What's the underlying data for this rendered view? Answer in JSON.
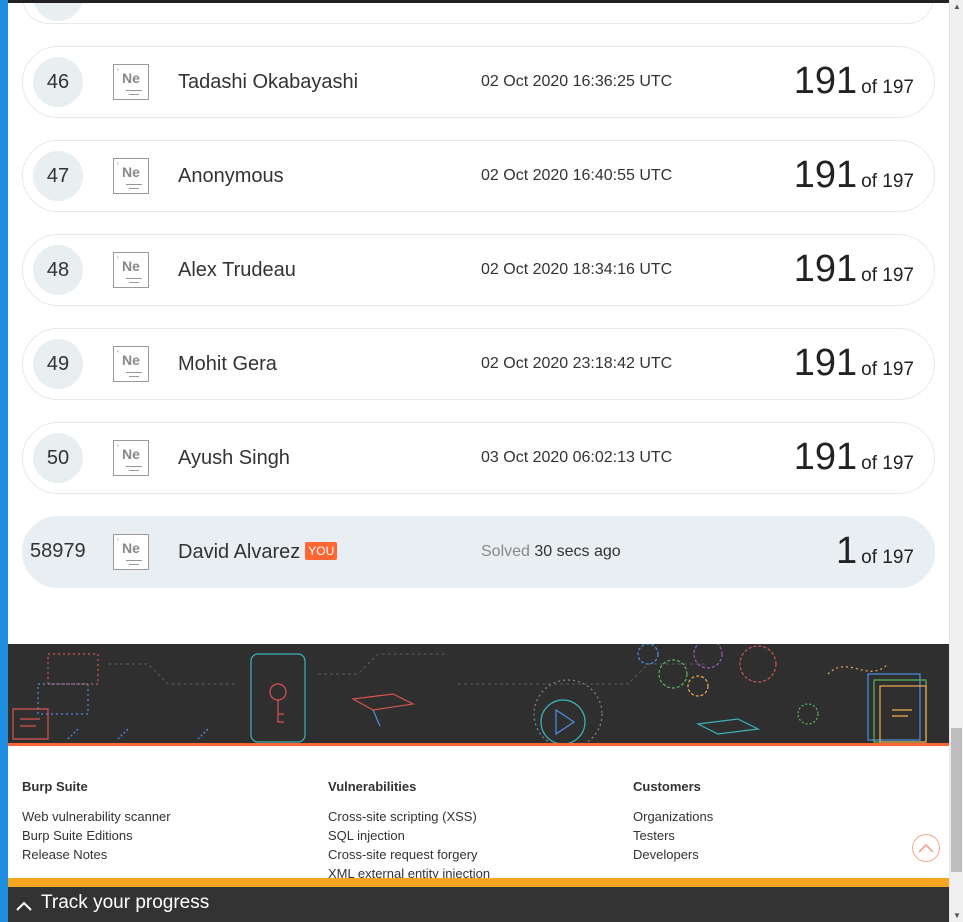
{
  "leaderboard": {
    "rows": [
      {
        "rank": "46",
        "badge": "Ne",
        "name": "Tadashi Okabayashi",
        "time": "02 Oct 2020 16:36:25 UTC",
        "score": "191",
        "of": "of 197"
      },
      {
        "rank": "47",
        "badge": "Ne",
        "name": "Anonymous",
        "time": "02 Oct 2020 16:40:55 UTC",
        "score": "191",
        "of": "of 197"
      },
      {
        "rank": "48",
        "badge": "Ne",
        "name": "Alex Trudeau",
        "time": "02 Oct 2020 18:34:16 UTC",
        "score": "191",
        "of": "of 197"
      },
      {
        "rank": "49",
        "badge": "Ne",
        "name": "Mohit Gera",
        "time": "02 Oct 2020 23:18:42 UTC",
        "score": "191",
        "of": "of 197"
      },
      {
        "rank": "50",
        "badge": "Ne",
        "name": "Ayush Singh",
        "time": "03 Oct 2020 06:02:13 UTC",
        "score": "191",
        "of": "of 197"
      }
    ],
    "current_user": {
      "rank": "58979",
      "badge": "Ne",
      "name": "David Alvarez",
      "you_tag": "YOU",
      "solved_label": "Solved",
      "solved_ago": "30 secs ago",
      "score": "1",
      "of": "of 197"
    }
  },
  "footer": {
    "columns": [
      {
        "heading": "Burp Suite",
        "links": [
          "Web vulnerability scanner",
          "Burp Suite Editions",
          "Release Notes"
        ]
      },
      {
        "heading": "Vulnerabilities",
        "links": [
          "Cross-site scripting (XSS)",
          "SQL injection",
          "Cross-site request forgery",
          "XML external entity injection"
        ]
      },
      {
        "heading": "Customers",
        "links": [
          "Organizations",
          "Testers",
          "Developers"
        ]
      }
    ],
    "back_to_top_icon": "chevron-up-circle-icon"
  },
  "track_bar": {
    "label": "Track your progress",
    "icon": "chevron-up-icon"
  },
  "colors": {
    "accent": "#ff6633",
    "track_stripe": "#f5a623",
    "banner_bg": "#2f2f2f",
    "row_highlight": "#e8eef1",
    "page_edge": "#1e8fe0"
  }
}
